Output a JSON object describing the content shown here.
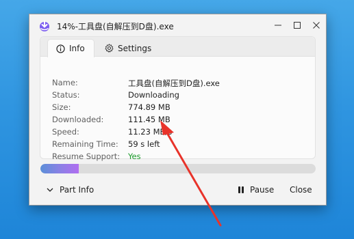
{
  "window": {
    "title": "14%-工具盘(自解压到D盘).exe",
    "minimize_icon": "minimize-icon",
    "maximize_icon": "maximize-icon",
    "close_icon": "close-icon"
  },
  "tabs": [
    {
      "label": "Info",
      "icon": "info-icon",
      "active": true
    },
    {
      "label": "Settings",
      "icon": "gear-icon",
      "active": false
    }
  ],
  "info": {
    "name_label": "Name:",
    "name_value": "工具盘(自解压到D盘).exe",
    "status_label": "Status:",
    "status_value": "Downloading",
    "size_label": "Size:",
    "size_value": "774.89 MB",
    "downloaded_label": "Downloaded:",
    "downloaded_value": "111.45 MB",
    "speed_label": "Speed:",
    "speed_value": "11.23 MB/s",
    "remaining_label": "Remaining Time:",
    "remaining_value": "59 s left",
    "resume_label": "Resume Support:",
    "resume_value": "Yes"
  },
  "progress": {
    "fraction": 0.14
  },
  "footer": {
    "part_info_label": "Part Info",
    "pause_label": "Pause",
    "close_label": "Close"
  },
  "colors": {
    "accent_progress": "#b06ef0",
    "resume_yes": "#1a9a2a",
    "annotation_arrow": "#e8332a"
  }
}
